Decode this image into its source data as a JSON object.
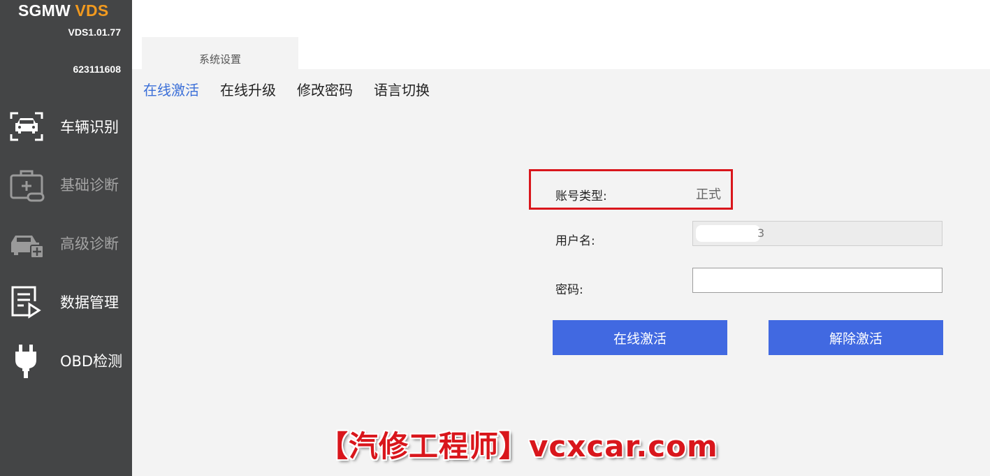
{
  "app": {
    "brand_part1": "SGMW",
    "brand_part2": "VDS",
    "version": "VDS1.01.77",
    "device_id": "623111608"
  },
  "sidebar": {
    "items": [
      {
        "label": "车辆识别",
        "icon": "car-scan-icon",
        "enabled": true
      },
      {
        "label": "基础诊断",
        "icon": "medical-kit-icon",
        "enabled": false
      },
      {
        "label": "高级诊断",
        "icon": "car-plus-icon",
        "enabled": false
      },
      {
        "label": "数据管理",
        "icon": "document-play-icon",
        "enabled": true
      },
      {
        "label": "OBD检测",
        "icon": "plug-icon",
        "enabled": true
      }
    ]
  },
  "main": {
    "tab_title": "系统设置",
    "subtabs": [
      "在线激活",
      "在线升级",
      "修改密码",
      "语言切换"
    ],
    "active_subtab": 0,
    "form": {
      "account_type_label": "账号类型:",
      "account_type_value": "正式",
      "username_label": "用户名:",
      "username_value_tail": "3",
      "password_label": "密码:",
      "password_value": "",
      "activate_button": "在线激活",
      "deactivate_button": "解除激活"
    }
  },
  "watermark": "【汽修工程师】vcxcar.com",
  "colors": {
    "sidebar_bg": "#444546",
    "brand_accent": "#f29a1f",
    "active_tab": "#3b6fd8",
    "button_bg": "#4169e1",
    "highlight": "#d9161c"
  }
}
